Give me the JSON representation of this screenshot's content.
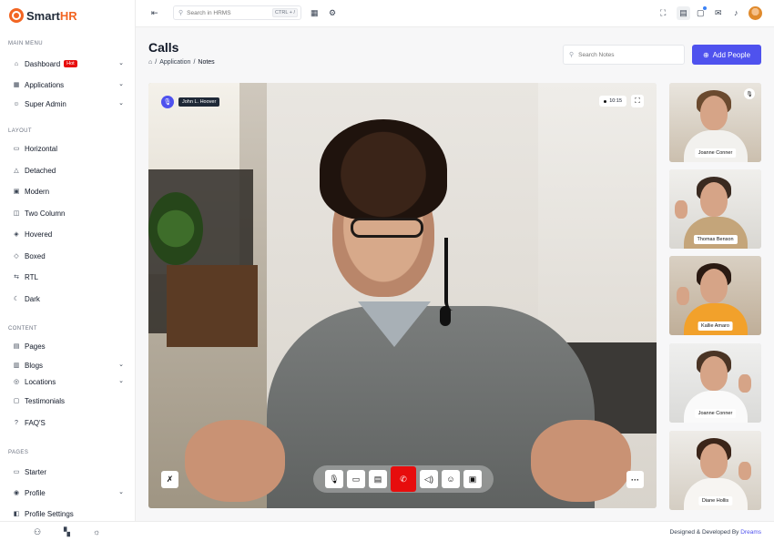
{
  "brand": {
    "name_main": "Smart",
    "name_accent": "HR",
    "accent_color": "#f26522"
  },
  "sidebar": {
    "sections": [
      {
        "label": "MAIN MENU"
      },
      {
        "label": "LAYOUT"
      },
      {
        "label": "CONTENT"
      },
      {
        "label": "PAGES"
      }
    ],
    "items": [
      {
        "label": "Dashboard",
        "icon": "home-icon",
        "badge": "Hot",
        "chevron": "⌄"
      },
      {
        "label": "Applications",
        "icon": "apps-icon",
        "chevron": "⌄"
      },
      {
        "label": "Super Admin",
        "icon": "user-star-icon",
        "chevron": "⌄"
      },
      {
        "label": "Horizontal",
        "icon": "layout-icon"
      },
      {
        "label": "Detached",
        "icon": "warning-icon"
      },
      {
        "label": "Modern",
        "icon": "grid-icon"
      },
      {
        "label": "Two Column",
        "icon": "columns-icon"
      },
      {
        "label": "Hovered",
        "icon": "layers-icon"
      },
      {
        "label": "Boxed",
        "icon": "box-icon"
      },
      {
        "label": "RTL",
        "icon": "rtl-icon"
      },
      {
        "label": "Dark",
        "icon": "moon-icon"
      },
      {
        "label": "Pages",
        "icon": "pages-icon"
      },
      {
        "label": "Blogs",
        "icon": "blog-icon",
        "chevron": "⌄"
      },
      {
        "label": "Locations",
        "icon": "location-icon",
        "chevron": "⌄"
      },
      {
        "label": "Testimonials",
        "icon": "message-icon"
      },
      {
        "label": "FAQ'S",
        "icon": "question-icon"
      },
      {
        "label": "Starter",
        "icon": "layout-icon"
      },
      {
        "label": "Profile",
        "icon": "profile-icon",
        "chevron": "⌄"
      },
      {
        "label": "Profile Settings",
        "icon": "settings-icon"
      }
    ]
  },
  "topbar": {
    "search_placeholder": "Search in HRMS",
    "shortcut": "CTRL + /"
  },
  "page": {
    "title": "Calls",
    "breadcrumb": [
      "Application",
      "Notes"
    ],
    "search_placeholder": "Search Notes",
    "add_button": "Add People",
    "accent_color": "#4f52ee"
  },
  "call": {
    "speaker_name": "John L. Hoover",
    "timer": "10:15",
    "end_color": "#e70d0d"
  },
  "participants": [
    {
      "name": "Joanne Conner"
    },
    {
      "name": "Thomas Benson"
    },
    {
      "name": "Kallie Amaro"
    },
    {
      "name": "Joanne Conner"
    },
    {
      "name": "Diane Hollis"
    }
  ],
  "footer": {
    "text": "Designed & Developed By",
    "brand": "Dreams"
  }
}
